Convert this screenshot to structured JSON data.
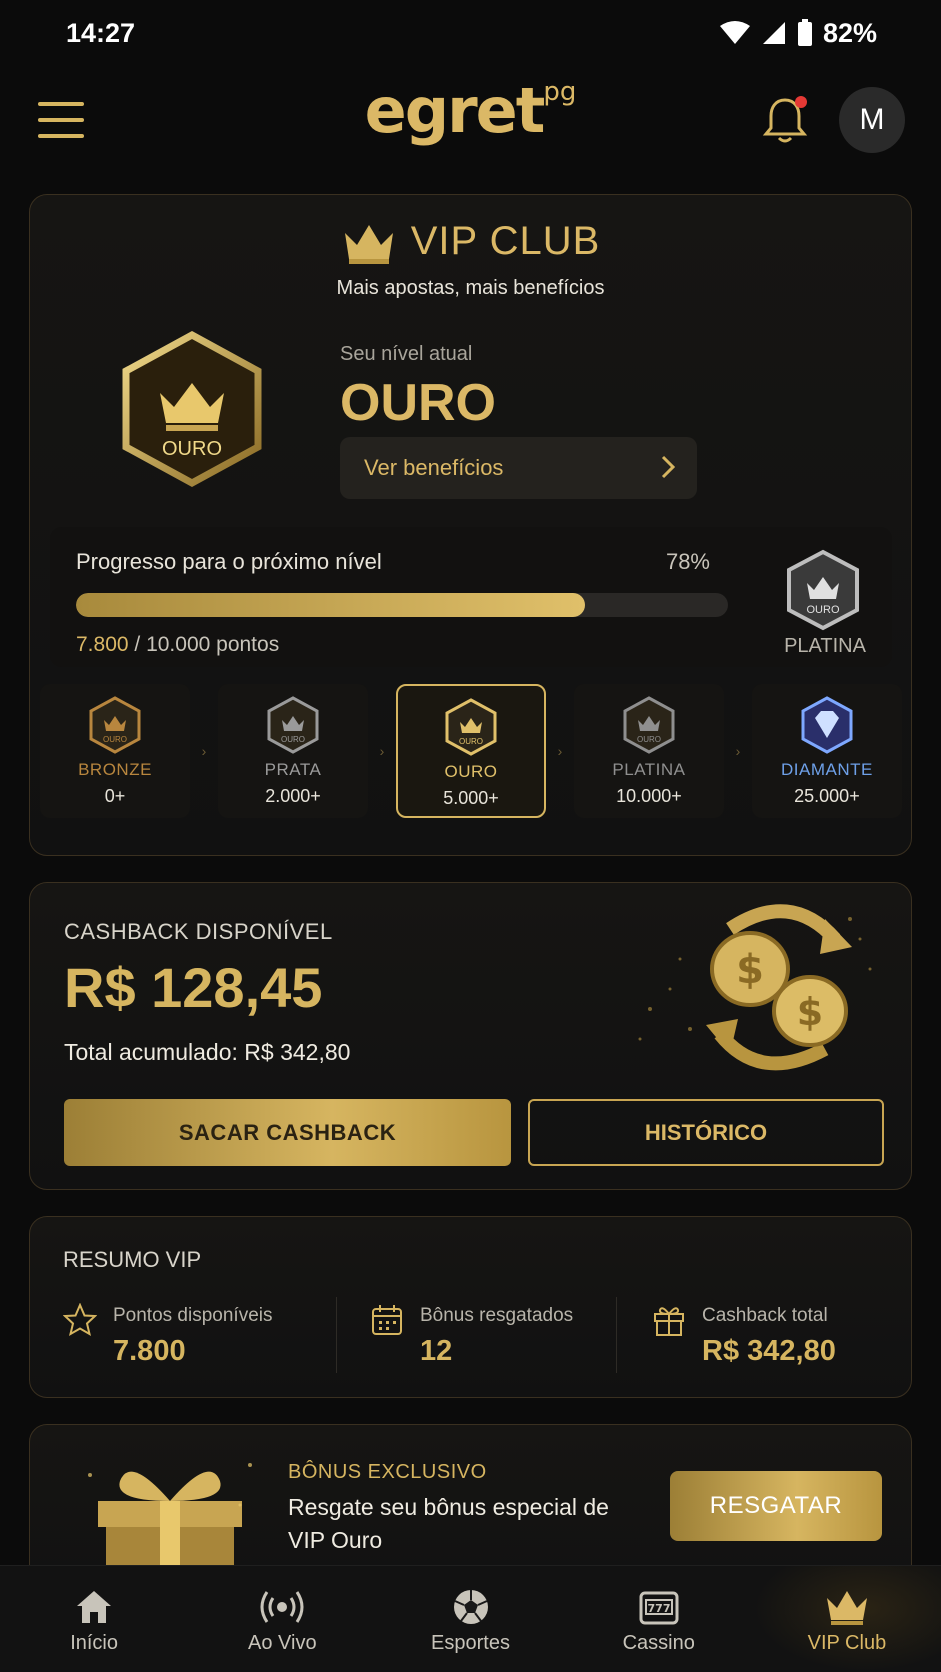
{
  "status_bar": {
    "time": "14:27",
    "battery": "82%"
  },
  "header": {
    "logo_main": "egret",
    "logo_sup": "pg",
    "avatar_initial": "M"
  },
  "vip": {
    "title": "VIP CLUB",
    "subtitle": "Mais apostas, mais benefícios",
    "badge_label": "OURO",
    "current_level_label": "Seu nível atual",
    "current_level": "OURO",
    "benefits_button": "Ver benefícios",
    "progress": {
      "label": "Progresso para o próximo nível",
      "percent_text": "78%",
      "percent": 78,
      "current_points": "7.800",
      "target_text": "/ 10.000 pontos",
      "next_badge_label": "OURO",
      "next_level": "PLATINA"
    },
    "levels": [
      {
        "name": "BRONZE",
        "points": "0+",
        "badge": "OURO",
        "color": "#b8863e"
      },
      {
        "name": "PRATA",
        "points": "2.000+",
        "badge": "OURO",
        "color": "#9a9a9a"
      },
      {
        "name": "OURO",
        "points": "5.000+",
        "badge": "OURO",
        "color": "#e0c06a"
      },
      {
        "name": "PLATINA",
        "points": "10.000+",
        "badge": "OURO",
        "color": "#8f8f8f"
      },
      {
        "name": "DIAMANTE",
        "points": "25.000+",
        "badge": "",
        "color": "#6ea0e8"
      }
    ]
  },
  "cashback": {
    "label": "CASHBACK DISPONÍVEL",
    "amount": "R$ 128,45",
    "total": "Total acumulado: R$ 342,80",
    "withdraw_button": "SACAR CASHBACK",
    "history_button": "HISTÓRICO"
  },
  "summary": {
    "title": "RESUMO VIP",
    "items": [
      {
        "label": "Pontos disponíveis",
        "value": "7.800",
        "icon": "star-icon"
      },
      {
        "label": "Bônus resgatados",
        "value": "12",
        "icon": "calendar-icon"
      },
      {
        "label": "Cashback total",
        "value": "R$ 342,80",
        "icon": "gift-icon"
      }
    ]
  },
  "bonus": {
    "label": "BÔNUS EXCLUSIVO",
    "text": "Resgate seu bônus especial de VIP Ouro",
    "button": "RESGATAR"
  },
  "nav": {
    "items": [
      {
        "label": "Início",
        "icon": "home-icon"
      },
      {
        "label": "Ao Vivo",
        "icon": "live-icon"
      },
      {
        "label": "Esportes",
        "icon": "soccer-ball-icon"
      },
      {
        "label": "Cassino",
        "icon": "slot-machine-icon"
      },
      {
        "label": "VIP Club",
        "icon": "crown-icon",
        "active": true
      }
    ]
  },
  "colors": {
    "accent": "#d6b560",
    "background": "#0b0b0b",
    "card": "#141311"
  }
}
